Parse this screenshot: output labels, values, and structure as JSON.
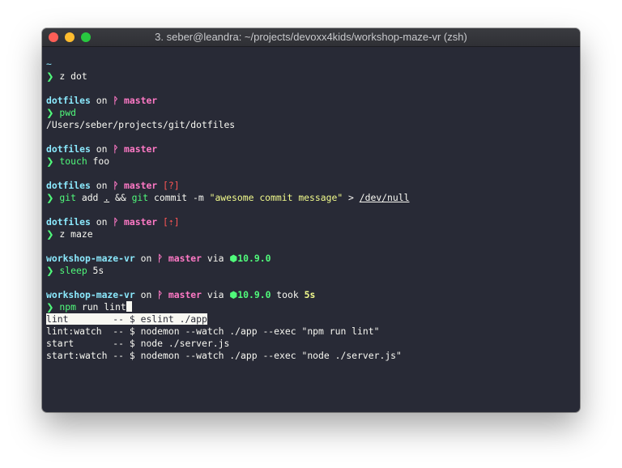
{
  "window": {
    "title": "3. seber@leandra: ~/projects/devoxx4kids/workshop-maze-vr (zsh)"
  },
  "icons": {
    "prompt": "❯",
    "branch": "ᚹ",
    "node": "⬢"
  },
  "session": {
    "home_dir": "~",
    "cmd1": "z dot",
    "block2": {
      "dir": "dotfiles",
      "on": "on",
      "branch": "master",
      "cmd": "pwd",
      "output": "/Users/seber/projects/git/dotfiles"
    },
    "block3": {
      "dir": "dotfiles",
      "on": "on",
      "branch": "master",
      "cmd_name": "touch",
      "cmd_args": " foo"
    },
    "block4": {
      "dir": "dotfiles",
      "on": "on",
      "branch": "master",
      "status": "[?]",
      "git1": "git",
      "add": " add ",
      "dot": ".",
      "and": " && ",
      "git2": "git",
      "commit": " commit -m ",
      "message": "\"awesome commit message\"",
      "redirect": " > ",
      "devnull": "/dev/null"
    },
    "block5": {
      "dir": "dotfiles",
      "on": "on",
      "branch": "master",
      "status": "[⇡]",
      "cmd": "z maze"
    },
    "block6": {
      "dir": "workshop-maze-vr",
      "on": "on",
      "branch": "master",
      "via": "via",
      "node_version": "10.9.0",
      "cmd_name": "sleep",
      "cmd_args": " 5s"
    },
    "block7": {
      "dir": "workshop-maze-vr",
      "on": "on",
      "branch": "master",
      "via": "via",
      "node_version": "10.9.0",
      "took": "took",
      "duration": "5s",
      "cmd_name": "npm",
      "cmd_args": " run lint"
    },
    "completions": [
      {
        "name": "lint       ",
        "desc": " -- $ eslint ./app"
      },
      {
        "name": "lint:watch ",
        "desc": " -- $ nodemon --watch ./app --exec \"npm run lint\""
      },
      {
        "name": "start      ",
        "desc": " -- $ node ./server.js"
      },
      {
        "name": "start:watch",
        "desc": " -- $ nodemon --watch ./app --exec \"node ./server.js\""
      }
    ]
  }
}
